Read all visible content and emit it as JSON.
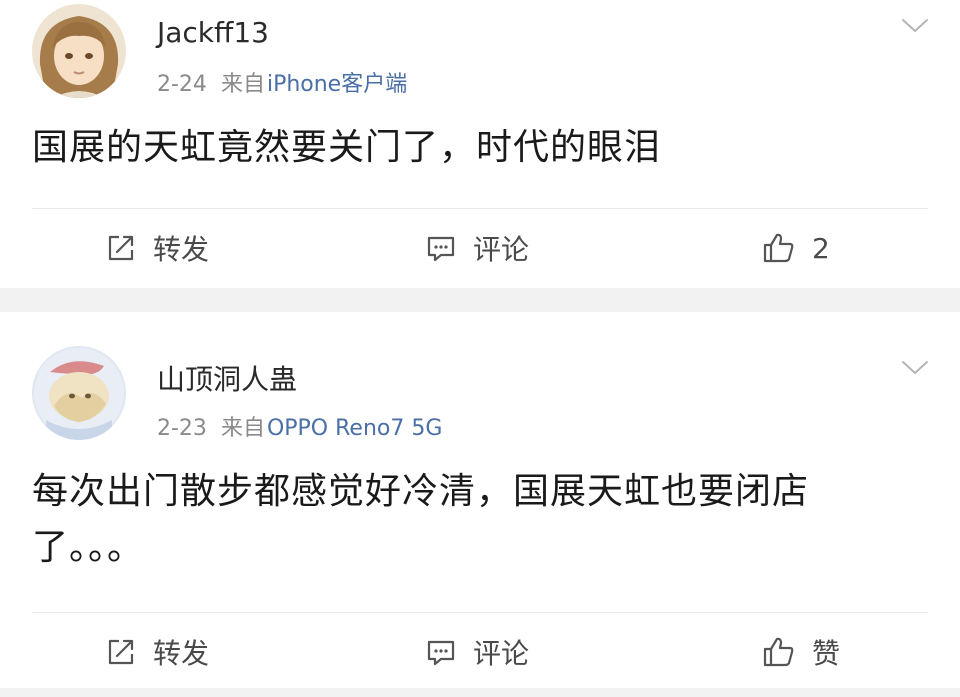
{
  "posts": [
    {
      "username": "Jackff13",
      "date": "2-24",
      "source_prefix": "来自",
      "source": "iPhone客户端",
      "content": "国展的天虹竟然要关门了，时代的眼泪",
      "actions": {
        "repost_label": "转发",
        "comment_label": "评论",
        "like_label": "2"
      }
    },
    {
      "username": "山顶洞人蛊",
      "date": "2-23",
      "source_prefix": "来自",
      "source": "OPPO Reno7 5G",
      "content": "每次出门散步都感觉好冷清，国展天虹也要闭店了。。。",
      "actions": {
        "repost_label": "转发",
        "comment_label": "评论",
        "like_label": "赞"
      }
    }
  ],
  "icons": {
    "repost": "repost-icon",
    "comment": "comment-icon",
    "like": "like-icon",
    "more": "chevron-down-icon"
  },
  "colors": {
    "source_link": "#4a6fa6",
    "meta_gray": "#8a8a8a",
    "separator": "#f2f2f2"
  }
}
